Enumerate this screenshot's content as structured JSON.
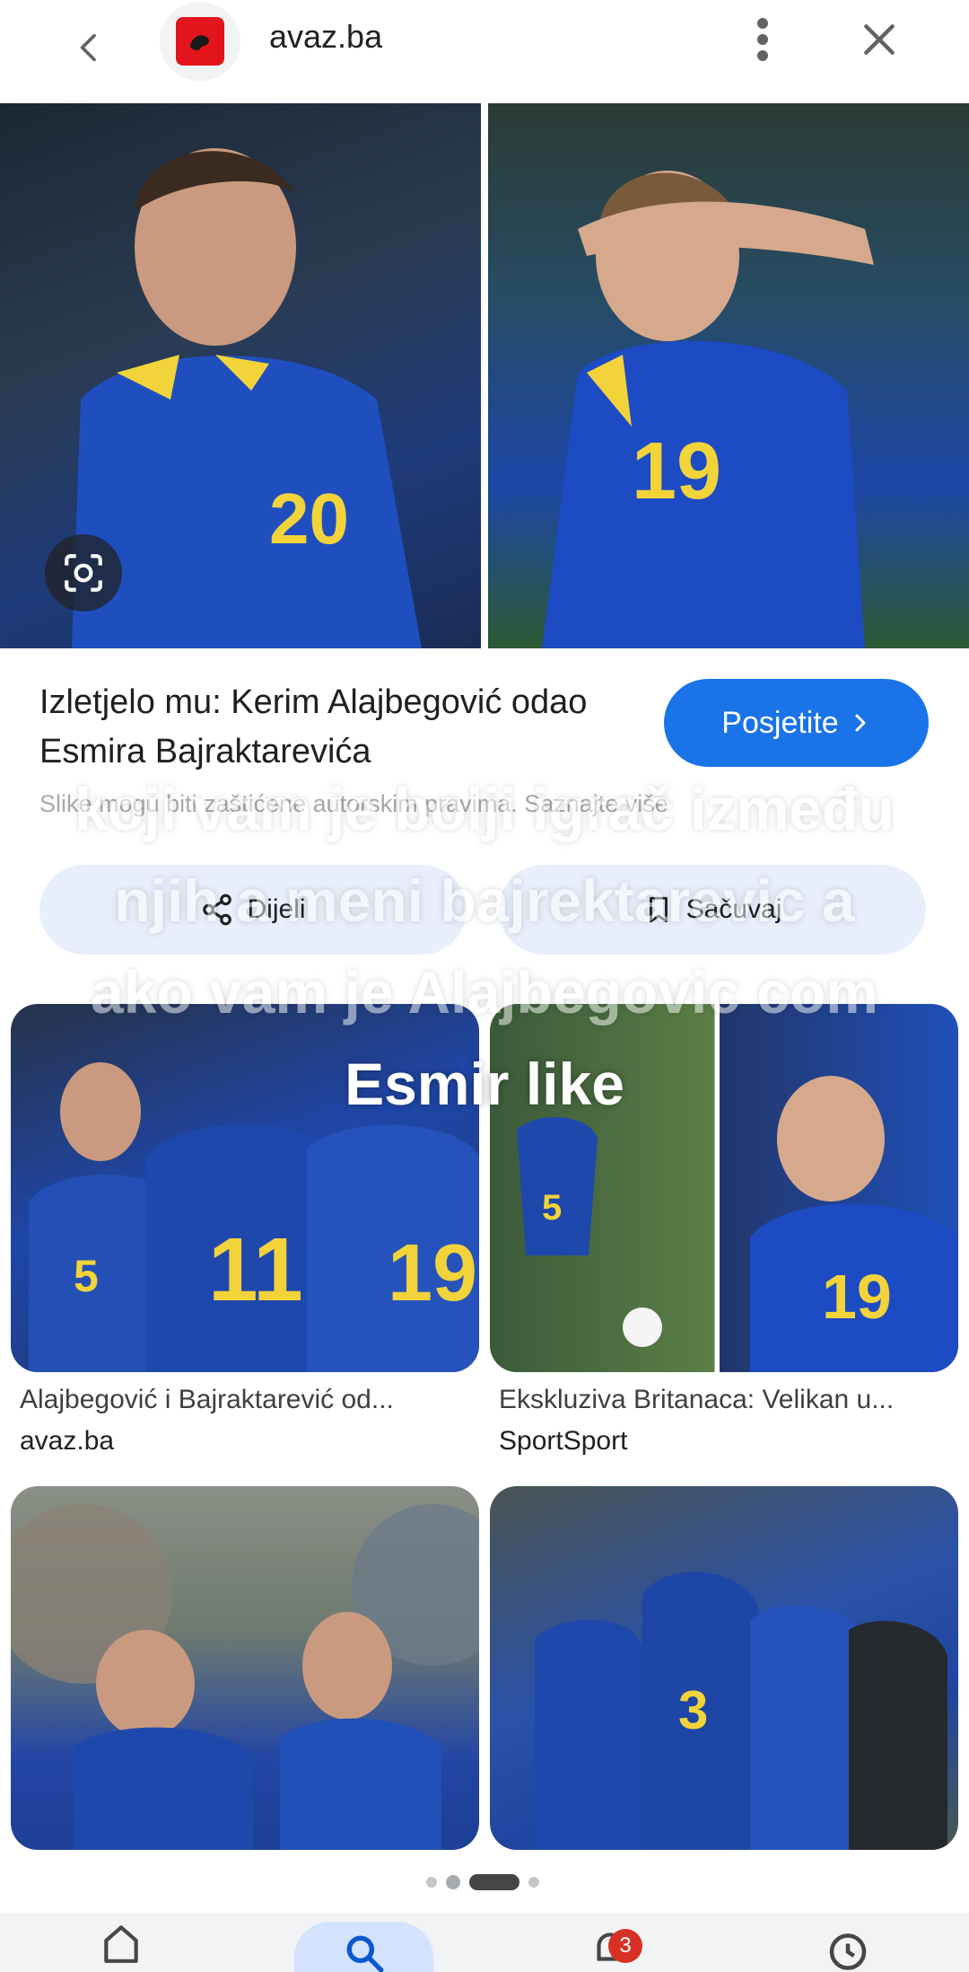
{
  "topbar": {
    "site_name": "avaz.ba"
  },
  "result": {
    "title": "Izletjelo mu: Kerim Alajbegović odao Esmira Bajraktarevića",
    "visit_label": "Posjetite",
    "license_text": "Slike mogu biti zaštićene autorskim pravima. Saznajte više",
    "share_label": "Dijeli",
    "save_label": "Sačuvaj"
  },
  "overlay_caption": {
    "line1": "koji vam je bolji igrač između",
    "line2": "njih a meni bajrektarevic a",
    "line3": "ako vam je Alajbegovic com",
    "line4": "Esmir like"
  },
  "related": [
    {
      "caption": "Alajbegović i Bajraktarević od...",
      "source": "avaz.ba"
    },
    {
      "caption": "Ekskluziva Britanaca: Velikan u...",
      "source": "SportSport"
    },
    {
      "caption": "",
      "source": ""
    },
    {
      "caption": "",
      "source": ""
    }
  ],
  "bottom_nav": {
    "notifications_badge": "3"
  },
  "colors": {
    "accent": "#1a73e8",
    "badge": "#d93025"
  }
}
